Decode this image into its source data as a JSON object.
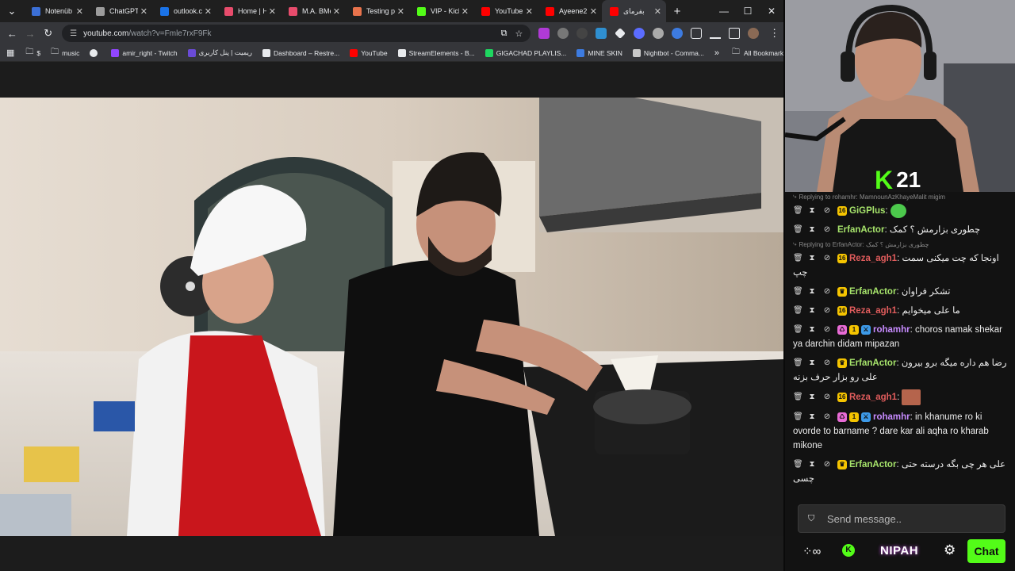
{
  "browser": {
    "tabs": [
      {
        "title": "Notenüb",
        "fav_color": "#3b6fd6",
        "active": false
      },
      {
        "title": "ChatGPT",
        "fav_color": "#9c9c9c",
        "active": false
      },
      {
        "title": "outlook.c",
        "fav_color": "#1a73e8",
        "active": false
      },
      {
        "title": "Home | H",
        "fav_color": "#e84c6c",
        "active": false
      },
      {
        "title": "M.A. BMe",
        "fav_color": "#e84c6c",
        "active": false
      },
      {
        "title": "Testing p",
        "fav_color": "#e8734c",
        "active": false
      },
      {
        "title": "VIP - Kick",
        "fav_color": "#53fc18",
        "active": false
      },
      {
        "title": "YouTube",
        "fav_color": "#ff0000",
        "active": false
      },
      {
        "title": "Ayeene2",
        "fav_color": "#ff0000",
        "active": false
      },
      {
        "title": "بفرمای",
        "fav_color": "#ff0000",
        "active": true
      }
    ],
    "new_tab": "+",
    "window_controls": {
      "minimize": "—",
      "maximize": "☐",
      "close": "✕"
    },
    "url_host": "youtube.com",
    "url_path": "/watch?v=Fmle7rxF9Fk",
    "bookmarks": [
      {
        "label": "$",
        "icon": "folder-icon"
      },
      {
        "label": "music",
        "icon": "folder-icon"
      },
      {
        "label": "",
        "icon": "globe-icon"
      },
      {
        "label": "amir_right - Twitch",
        "icon": "twitch-icon"
      },
      {
        "label": "ریمیت | پنل کاربری",
        "icon": "remit-icon"
      },
      {
        "label": "Dashboard – Restre...",
        "icon": "restream-icon"
      },
      {
        "label": "YouTube",
        "icon": "youtube-icon"
      },
      {
        "label": "StreamElements - B...",
        "icon": "streamelements-icon"
      },
      {
        "label": "GIGACHAD PLAYLIS...",
        "icon": "spotify-icon"
      },
      {
        "label": "MINE SKIN",
        "icon": "mineskin-icon"
      },
      {
        "label": "Nightbot - Comma...",
        "icon": "nightbot-icon"
      }
    ],
    "all_bookmarks": "All Bookmarks"
  },
  "stream": {
    "platform_letter": "K",
    "viewer_count": "21"
  },
  "chat": {
    "messages": [
      {
        "type": "reply",
        "text": "Replying to rohamhr: MamnounAzKhayeMalit migim"
      },
      {
        "type": "msg",
        "user": "GiGPlus",
        "color": "#a6e36b",
        "text": "",
        "badges": [
          "sub"
        ],
        "emote": true
      },
      {
        "type": "msg",
        "user": "ErfanActor",
        "color": "#a6e36b",
        "text": "چطوری بزارمش ؟ کمک",
        "badges": []
      },
      {
        "type": "reply",
        "text": "Replying to ErfanActor: چطوری بزارمش ؟ کمک"
      },
      {
        "type": "msg",
        "user": "Reza_agh1",
        "color": "#e05c5c",
        "text": "اونجا که چت میکنی سمت چپ",
        "badges": [
          "sub"
        ]
      },
      {
        "type": "msg",
        "user": "ErfanActor",
        "color": "#a6e36b",
        "text": "تشکر فراوان",
        "badges": [
          "vip"
        ]
      },
      {
        "type": "msg",
        "user": "Reza_agh1",
        "color": "#e05c5c",
        "text": "ما علی میخوایم",
        "badges": [
          "sub"
        ]
      },
      {
        "type": "msg",
        "user": "rohamhr",
        "color": "#c78bff",
        "text": "choros namak shekar ya darchin didam mipazan",
        "badges": [
          "og",
          "gift",
          "mod"
        ]
      },
      {
        "type": "msg",
        "user": "ErfanActor",
        "color": "#a6e36b",
        "text": "رضا هم داره میگه برو بیرون علی رو بزار حرف بزنه",
        "badges": [
          "vip"
        ]
      },
      {
        "type": "msg",
        "user": "Reza_agh1",
        "color": "#e05c5c",
        "text": "",
        "badges": [
          "sub"
        ],
        "image_emote": true
      },
      {
        "type": "msg",
        "user": "rohamhr",
        "color": "#c78bff",
        "text": "in khanume ro ki ovorde to barname ? dare kar ali aqha ro kharab mikone",
        "badges": [
          "og",
          "gift",
          "mod"
        ]
      },
      {
        "type": "msg",
        "user": "ErfanActor",
        "color": "#a6e36b",
        "text": "علی هر چی بگه درسته حتی چسی",
        "badges": [
          "vip"
        ]
      }
    ],
    "input_placeholder": "Send message..",
    "nipah_label": "NIPAH",
    "chat_button": "Chat"
  },
  "colors": {
    "kick_green": "#53fc18",
    "chat_bg": "#121212",
    "browser_dark": "#202124"
  }
}
